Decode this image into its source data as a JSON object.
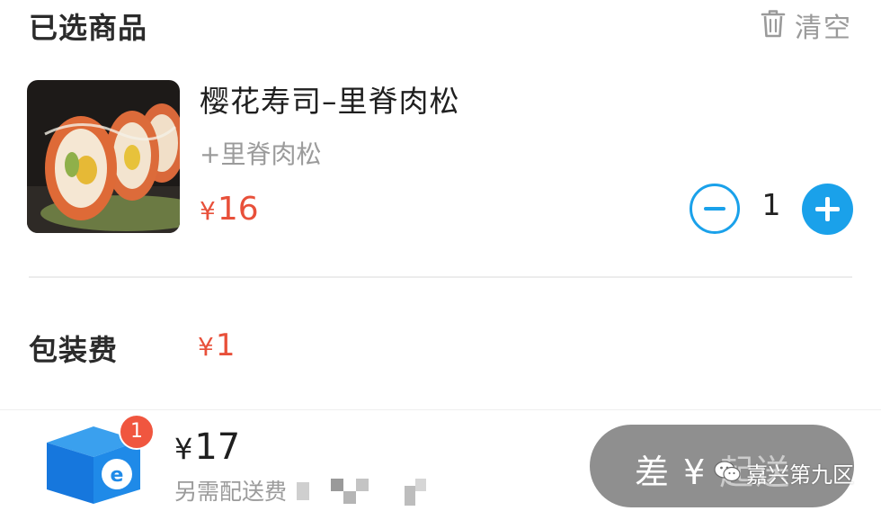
{
  "header": {
    "title": "已选商品",
    "clear_label": "清空"
  },
  "product": {
    "name": "樱花寿司–里脊肉松",
    "spec": "+里脊肉松",
    "price_symbol": "¥",
    "price": "16",
    "quantity": "1"
  },
  "packaging": {
    "label": "包装费",
    "price_symbol": "¥",
    "price": "1"
  },
  "footer": {
    "cart_badge": "1",
    "total_symbol": "¥",
    "total": "17",
    "delivery_note": "另需配送费",
    "checkout_label": "差 ¥",
    "checkout_label_tail": "起送",
    "watermark": "嘉兴第九区"
  },
  "colors": {
    "accent_blue": "#1aa1ea",
    "price_red": "#e8503a",
    "badge_red": "#f0563f",
    "disabled_gray": "#8f8f8f"
  },
  "icons": [
    "trash-icon",
    "minus-icon",
    "plus-icon",
    "cart-box-icon",
    "wechat-icon"
  ]
}
